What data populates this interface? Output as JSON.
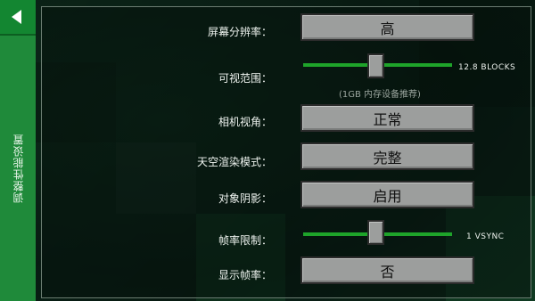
{
  "sidebar": {
    "title": "调整性能设置"
  },
  "settings": {
    "resolution": {
      "label": "屏幕分辨率：",
      "value": "高"
    },
    "view_distance": {
      "label": "可视范围：",
      "value_text": "12.8 BLOCKS",
      "level": 0.49,
      "hint": "(1GB 内存设备推荐)"
    },
    "fov": {
      "label": "相机视角：",
      "value": "正常"
    },
    "sky_render": {
      "label": "天空渲染模式：",
      "value": "完整"
    },
    "shadows": {
      "label": "对象阴影：",
      "value": "启用"
    },
    "frame_limit": {
      "label": "帧率限制：",
      "value_text": "1 VSYNC",
      "level": 0.49
    },
    "show_fps": {
      "label": "显示帧率：",
      "value": "否"
    }
  },
  "colors": {
    "sidebar": "#1f8a3a",
    "slider_track": "#1ea42a",
    "button_face": "#9c9e9d"
  }
}
